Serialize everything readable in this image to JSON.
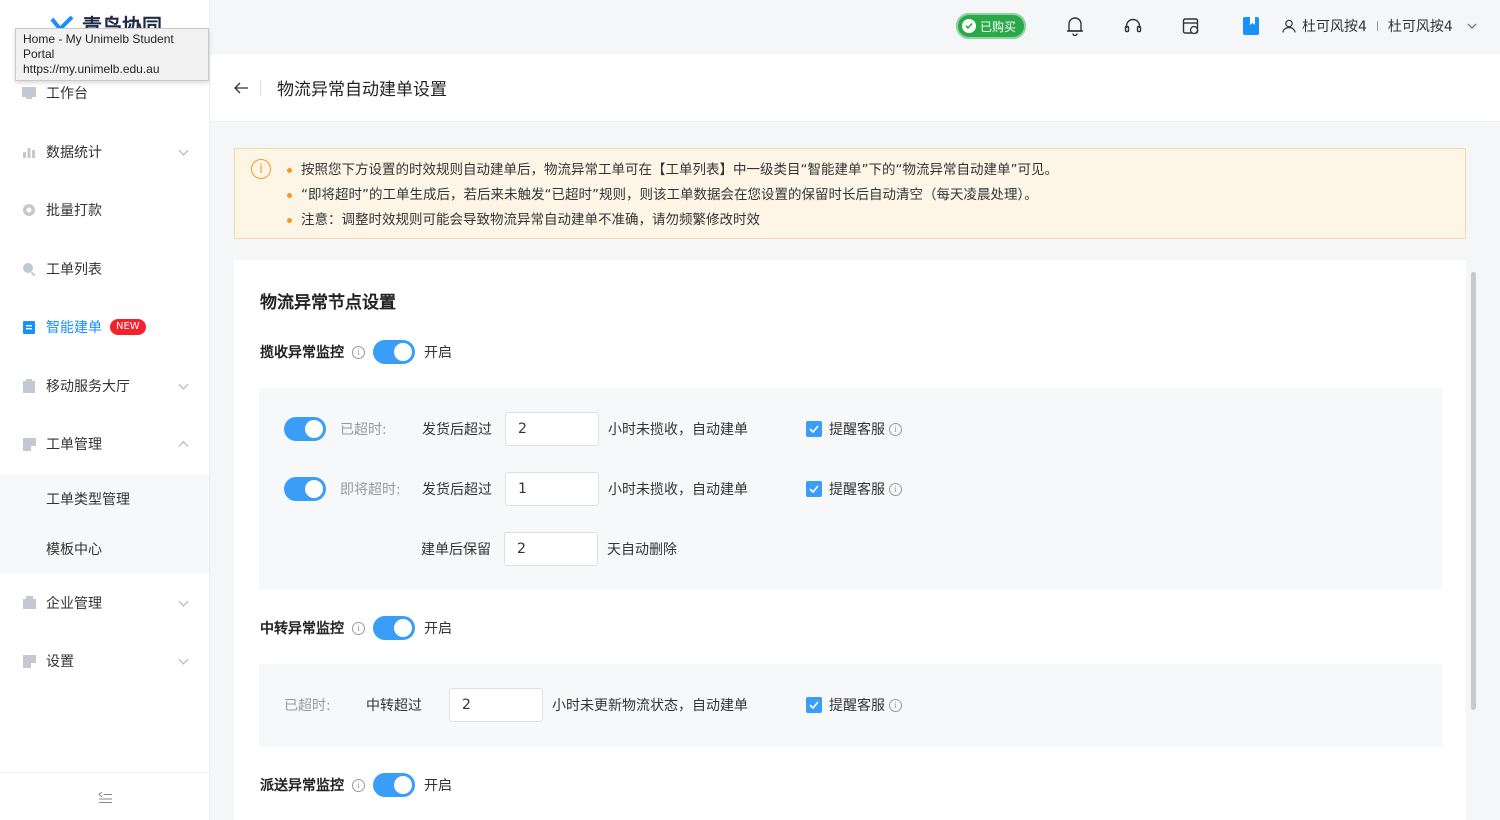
{
  "app": {
    "brand": "青鸟协同"
  },
  "tooltip": {
    "line1": "Home - My Unimelb Student Portal",
    "line2": "https://my.unimelb.edu.au"
  },
  "sidebar": {
    "items": [
      {
        "label": "工作台",
        "icon": "monitor-icon"
      },
      {
        "label": "数据统计",
        "icon": "bar-chart-icon"
      },
      {
        "label": "批量打款",
        "icon": "coin-icon"
      },
      {
        "label": "工单列表",
        "icon": "search-icon"
      },
      {
        "label": "智能建单",
        "icon": "document-icon",
        "badge": "NEW"
      },
      {
        "label": "移动服务大厅",
        "icon": "clipboard-icon"
      },
      {
        "label": "工单管理",
        "icon": "folder-icon"
      },
      {
        "label": "企业管理",
        "icon": "building-icon"
      },
      {
        "label": "设置",
        "icon": "settings-icon"
      }
    ],
    "sub_items": [
      {
        "label": "工单类型管理"
      },
      {
        "label": "模板中心"
      }
    ],
    "collapse_icon": "collapse-menu-icon"
  },
  "topbar": {
    "purchased_label": "已购买",
    "user_name": "杜可风按4",
    "company_name": "杜可风按4"
  },
  "page": {
    "title": "物流异常自动建单设置"
  },
  "notice": {
    "items": [
      "按照您下方设置的时效规则自动建单后，物流异常工单可在【工单列表】中一级类目“智能建单”下的“物流异常自动建单”可见。",
      "“即将超时”的工单生成后，若后来未触发“已超时”规则，则该工单数据会在您设置的保留时长后自动清空（每天凌晨处理）。",
      "注意：调整时效规则可能会导致物流异常自动建单不准确，请勿频繁修改时效"
    ]
  },
  "settings": {
    "title": "物流异常节点设置",
    "collect": {
      "label": "揽收异常监控",
      "state": "开启",
      "overdue": {
        "label": "已超时:",
        "prefix": "发货后超过",
        "value": "2",
        "suffix": "小时未揽收，自动建单",
        "remind": "提醒客服"
      },
      "near_overdue": {
        "label": "即将超时:",
        "prefix": "发货后超过",
        "value": "1",
        "suffix": "小时未揽收，自动建单",
        "remind": "提醒客服"
      },
      "retain": {
        "prefix": "建单后保留",
        "value": "2",
        "suffix": "天自动删除"
      }
    },
    "transit": {
      "label": "中转异常监控",
      "state": "开启",
      "overdue": {
        "label": "已超时:",
        "prefix": "中转超过",
        "value": "2",
        "suffix": "小时未更新物流状态，自动建单",
        "remind": "提醒客服"
      }
    },
    "delivery": {
      "label": "派送异常监控",
      "state": "开启"
    }
  }
}
